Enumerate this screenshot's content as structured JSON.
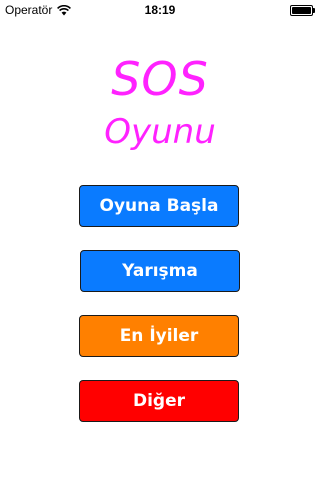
{
  "status_bar": {
    "carrier": "Operatör",
    "time": "18:19",
    "icons": [
      "wifi-icon",
      "battery-icon"
    ]
  },
  "title": {
    "line1": "SOS",
    "line2": "Oyunu",
    "color": "#ff22ff"
  },
  "menu": {
    "buttons": [
      {
        "label": "Oyuna Başla",
        "color": "#0a7bff"
      },
      {
        "label": "Yarışma",
        "color": "#0a7bff"
      },
      {
        "label": "En İyiler",
        "color": "#ff8000"
      },
      {
        "label": "Diğer",
        "color": "#ff0000"
      }
    ]
  }
}
